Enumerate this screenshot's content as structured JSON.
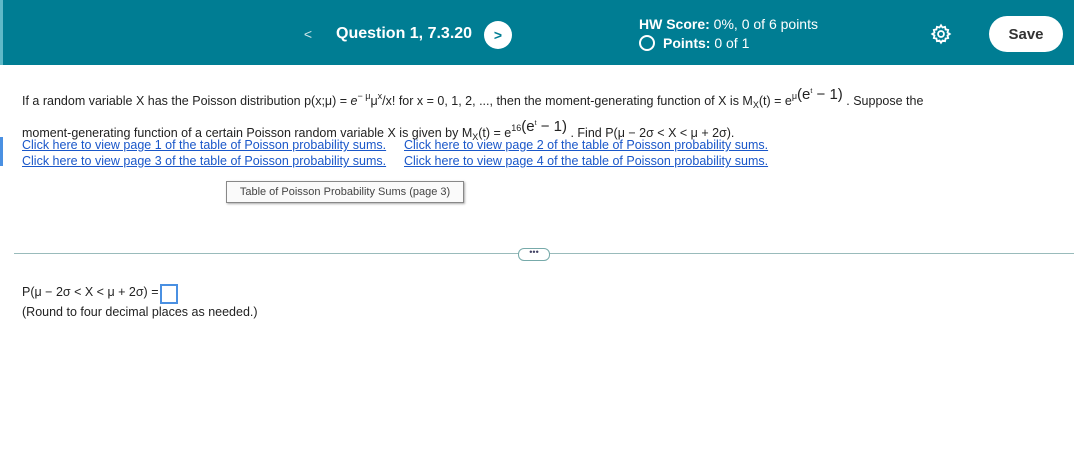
{
  "header": {
    "prev_label": "<",
    "question_title": "Question 1, 7.3.20",
    "next_label": ">",
    "hw_score_label": "HW Score:",
    "hw_score_value": " 0%, 0 of 6 points",
    "points_label": "Points:",
    "points_value": " 0 of 1",
    "save_label": "Save"
  },
  "problem": {
    "line1_a": "If a random variable X has the Poisson distribution p(x;μ) = ",
    "line1_pmf_e": "e",
    "line1_pmf_exp": "− μ",
    "line1_pmf_mu": "μ",
    "line1_pmf_x": "x",
    "line1_b": "/x! for x = 0, 1, 2, ..., then the moment-generating function of X is M",
    "line1_sub": "X",
    "line1_c": "(t) = e",
    "line1_mgf_exp": "μ",
    "line1_mgf_paren": "(e",
    "line1_mgf_t": "t",
    "line1_mgf_rest": " − 1)",
    "line1_d": " . Suppose the",
    "line2_a": "moment-generating function of a certain Poisson random variable X is given by M",
    "line2_sub": "X",
    "line2_b": "(t) = e",
    "line2_exp": "16",
    "line2_paren": "(e",
    "line2_t": "t",
    "line2_rest": " − 1)",
    "line2_c": " . Find P(μ − 2σ < X < μ + 2σ)."
  },
  "links": {
    "page1": "Click here to view page 1 of the table of Poisson probability sums.",
    "page2": "Click here to view page 2 of the table of Poisson probability sums.",
    "page3": "Click here to view page 3 of the table of Poisson probability sums.",
    "page4": "Click here to view page 4 of the table of Poisson probability sums."
  },
  "table_button": "Table of Poisson Probability Sums (page 3)",
  "more_button": "•••",
  "answer": {
    "label": "P(μ − 2σ < X < μ + 2σ) =",
    "value": "",
    "hint": "(Round to four decimal places as needed.)"
  },
  "colors": {
    "header_bg": "#007d93",
    "link": "#1a57c9",
    "input_border": "#4a90e2"
  },
  "icons": [
    "chevron-left-icon",
    "chevron-right-icon",
    "radio-icon",
    "gear-icon"
  ]
}
